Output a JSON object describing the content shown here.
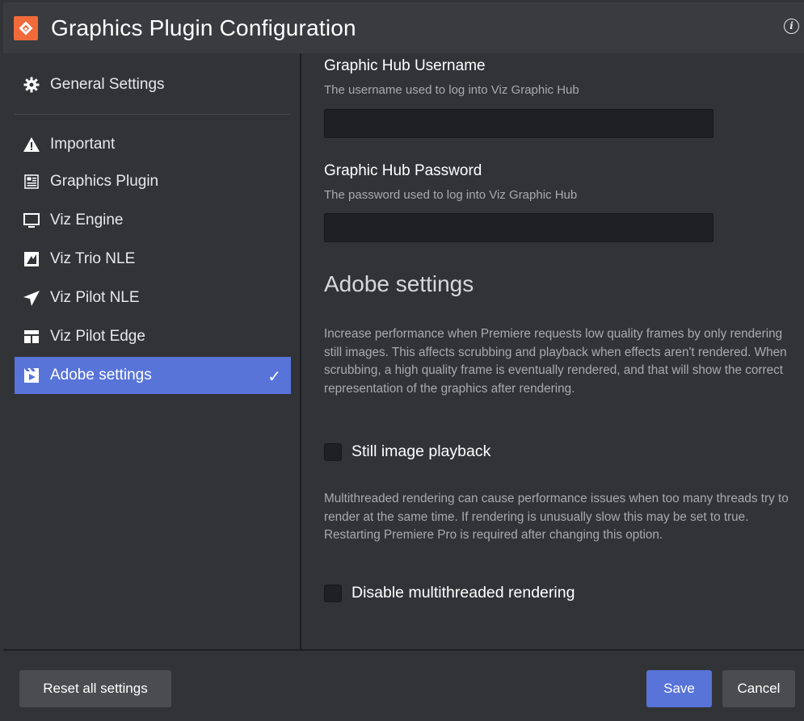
{
  "window": {
    "title": "Graphics Plugin Configuration"
  },
  "sidebar": {
    "items": [
      {
        "label": "General Settings",
        "icon": "gear-icon"
      },
      {
        "label": "Important",
        "icon": "warning-icon"
      },
      {
        "label": "Graphics Plugin",
        "icon": "plugin-icon"
      },
      {
        "label": "Viz Engine",
        "icon": "monitor-icon"
      },
      {
        "label": "Viz Trio NLE",
        "icon": "trio-icon"
      },
      {
        "label": "Viz Pilot NLE",
        "icon": "paper-plane-icon"
      },
      {
        "label": "Viz Pilot Edge",
        "icon": "layout-icon"
      },
      {
        "label": "Adobe settings",
        "icon": "clapperboard-icon",
        "active": true,
        "check": "✓"
      }
    ]
  },
  "main": {
    "username": {
      "label": "Graphic Hub Username",
      "description": "The username used to log into Viz Graphic Hub",
      "value": ""
    },
    "password": {
      "label": "Graphic Hub Password",
      "description": "The password used to log into Viz Graphic Hub",
      "value": ""
    },
    "adobe": {
      "heading": "Adobe settings",
      "still_description": "Increase performance when Premiere requests low quality frames by only rendering still images. This affects scrubbing and playback when effects aren't rendered. When scrubbing, a high quality frame is eventually rendered, and that will show the correct representation of the graphics after rendering.",
      "still_label": "Still image playback",
      "still_checked": false,
      "multi_description": "Multithreaded rendering can cause performance issues when too many threads try to render at the same time. If rendering is unusually slow this may be set to true. Restarting Premiere Pro is required after changing this option.",
      "multi_label": "Disable multithreaded rendering",
      "multi_checked": false
    }
  },
  "footer": {
    "reset_label": "Reset all settings",
    "save_label": "Save",
    "cancel_label": "Cancel"
  },
  "colors": {
    "accent": "#5874d8",
    "logo": "#f06a3a",
    "background": "#323337"
  }
}
